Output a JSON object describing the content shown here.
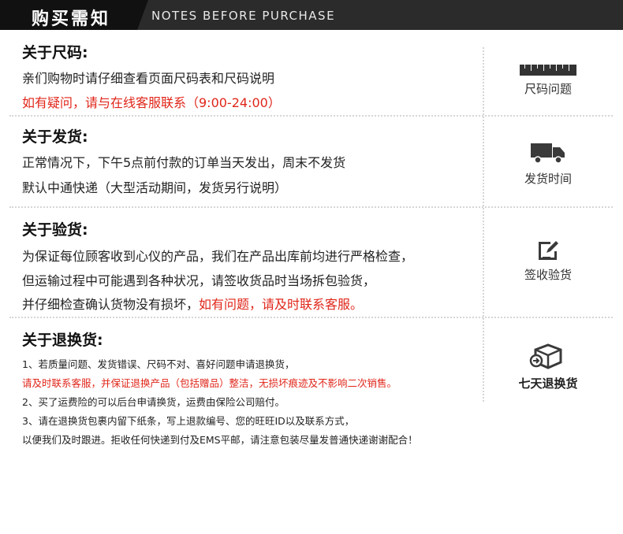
{
  "header": {
    "title": "购买需知",
    "subtitle": "NOTES BEFORE PURCHASE"
  },
  "sections": [
    {
      "title": "关于尺码:",
      "lines": [
        "亲们购物时请仔细查看页面尺码表和尺码说明"
      ],
      "red_line": "如有疑问，请与在线客服联系（9:00-24:00）",
      "side": {
        "label": "尺码问题",
        "icon": "ruler-icon"
      }
    },
    {
      "title": "关于发货:",
      "lines": [
        "正常情况下，下午5点前付款的订单当天发出，周末不发货",
        "默认中通快递（大型活动期间，发货另行说明）"
      ],
      "side": {
        "label": "发货时间",
        "icon": "truck-icon"
      }
    },
    {
      "title": "关于验货:",
      "lines": [
        "为保证每位顾客收到心仪的产品，我们在产品出库前均进行严格检查，",
        "但运输过程中可能遇到各种状况，请签收货品时当场拆包验货，"
      ],
      "last_line_black": "并仔细检查确认货物没有损坏，",
      "last_line_red": "如有问题，请及时联系客服。",
      "side": {
        "label": "签收验货",
        "icon": "sign-edit-icon"
      }
    },
    {
      "title": "关于退换货:",
      "lines": [
        "1、若质量问题、发货错误、尺码不对、喜好问题申请退换货，",
        "请及时联系客服，并保证退换产品（包括赠品）整洁，无损坏痕迹及不影响二次销售。",
        "2、买了运费险的可以后台申请换货，运费由保险公司赔付。",
        "3、请在退换货包裹内留下纸条，写上退款编号、您的旺旺ID以及联系方式，",
        "以便我们及时跟进。拒收任何快递到付及EMS平邮，请注意包装尽量发普通快递谢谢配合！"
      ],
      "side": {
        "label": "七天退换货",
        "icon": "return-box-icon"
      }
    }
  ],
  "colors": {
    "accent_red": "#e0261a",
    "header_bg": "#2b2b2b"
  }
}
